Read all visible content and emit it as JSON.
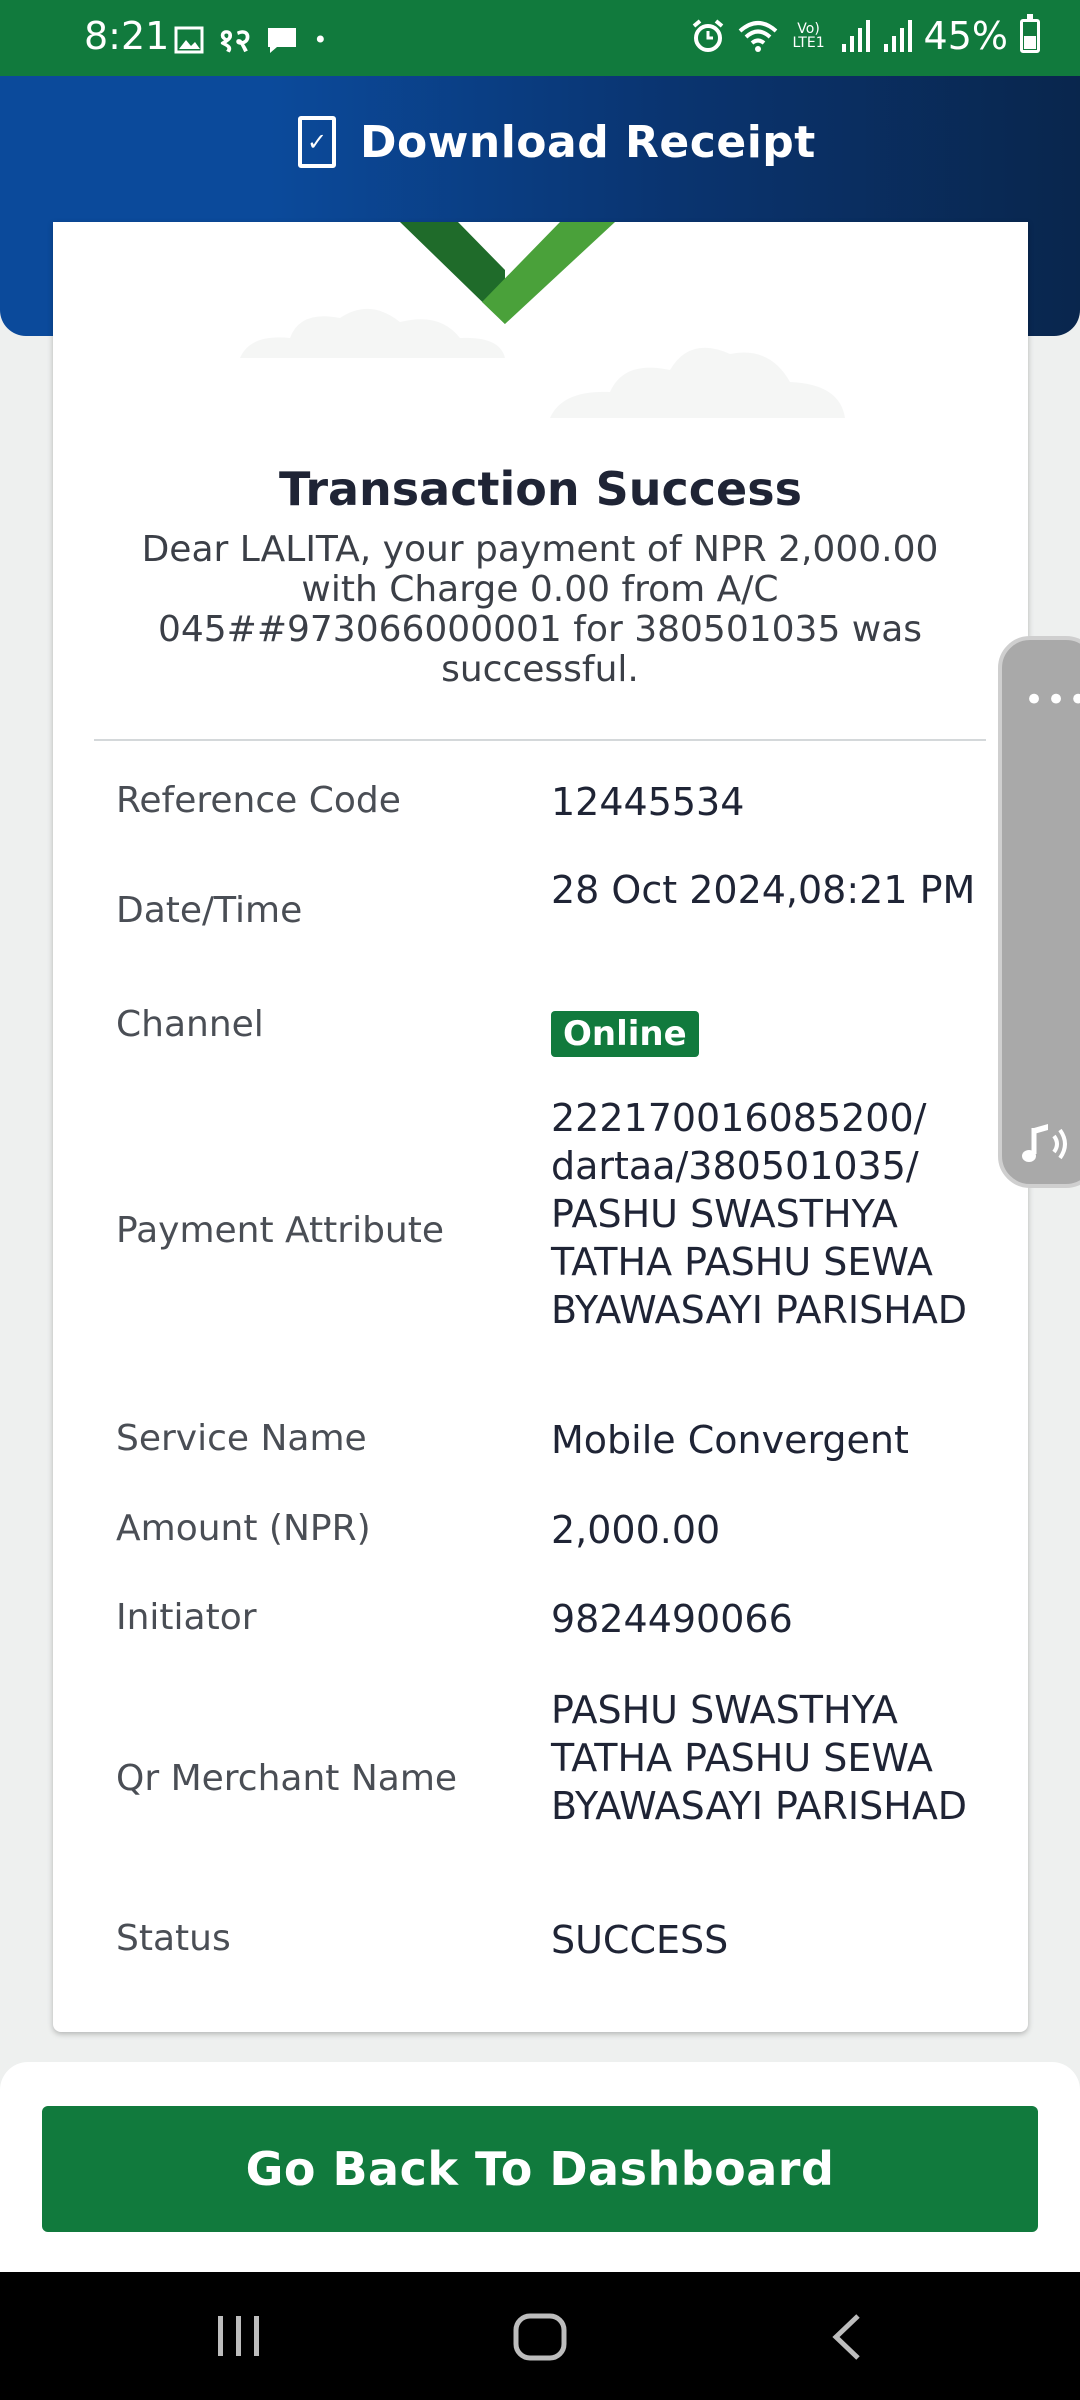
{
  "status_bar": {
    "time": "8:21",
    "battery": "45%",
    "icons_left": [
      "image-icon",
      "notification-text-icon",
      "message-icon",
      "dot-icon"
    ],
    "icons_right": [
      "alarm-icon",
      "wifi-icon",
      "volte-icon",
      "signal-icon",
      "signal-icon",
      "battery-icon"
    ],
    "left_glyph_text": "१२",
    "volte_text": "Vo) LTE1"
  },
  "header": {
    "title": "Download Receipt",
    "icon": "pdf-download-icon",
    "colors": {
      "start": "#0b4a9b",
      "end": "#09264d"
    }
  },
  "receipt": {
    "title": "Transaction Success",
    "message": "Dear LALITA, your payment of NPR 2,000.00 with Charge 0.00 from A/C 045##973066000001 for 380501035 was successful.",
    "rows": [
      {
        "label": "Reference Code",
        "value": "12445534"
      },
      {
        "label": "Date/Time",
        "value": "28 Oct 2024,08:21 PM"
      },
      {
        "label": "Channel",
        "value": "Online"
      },
      {
        "label": "Payment Attribute",
        "value": "222170016085200/ dartaa/380501035/ PASHU SWASTHYA TATHA PASHU SEWA BYAWASAYI PARISHAD"
      },
      {
        "label": "Service Name",
        "value": "Mobile Convergent"
      },
      {
        "label": "Amount (NPR)",
        "value": "2,000.00"
      },
      {
        "label": "Initiator",
        "value": "9824490066"
      },
      {
        "label": "Qr Merchant Name",
        "value": "PASHU SWASTHYA TATHA PASHU SEWA BYAWASAYI PARISHAD"
      },
      {
        "label": "Status",
        "value": "SUCCESS"
      }
    ]
  },
  "side_pill": {
    "dots": "•••",
    "icon": "accessibility-sound-icon"
  },
  "actions": {
    "dashboard_button": "Go Back To Dashboard"
  },
  "nav": {
    "recent": "|||",
    "home": "○",
    "back": "<"
  },
  "colors": {
    "accent": "#117a3d",
    "status_bar": "#117a3d"
  }
}
